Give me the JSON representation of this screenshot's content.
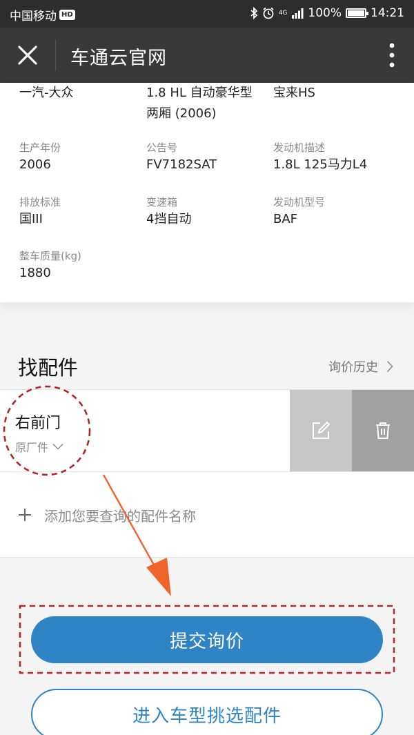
{
  "status_bar": {
    "carrier": "中国移动",
    "hd": "HD",
    "network": "4G",
    "battery": "100%",
    "battery_level": 1.0,
    "time": "14:21"
  },
  "nav": {
    "title": "车通云官网",
    "icons": {
      "close": "close-icon",
      "more": "more-icon"
    }
  },
  "vehicle": {
    "brand": "一汽-大众",
    "model_line1": "1.8 HL 自动豪华型",
    "model_line2": "两厢 (2006)",
    "series": "宝来HS",
    "fields": [
      {
        "label": "生产年份",
        "value": "2006"
      },
      {
        "label": "公告号",
        "value": "FV7182SAT"
      },
      {
        "label": "发动机描述",
        "value": "1.8L 125马力L4"
      },
      {
        "label": "排放标准",
        "value": "国III"
      },
      {
        "label": "变速箱",
        "value": "4挡自动"
      },
      {
        "label": "发动机型号",
        "value": "BAF"
      },
      {
        "label": "整车质量(kg)",
        "value": "1880"
      }
    ]
  },
  "parts": {
    "title": "找配件",
    "history_link": "询价历史",
    "items": [
      {
        "name": "右前门",
        "type": "原厂件"
      }
    ],
    "add_placeholder": "添加您要查询的配件名称"
  },
  "buttons": {
    "submit": "提交询价",
    "select_by_model": "进入车型挑选配件"
  },
  "colors": {
    "primary": "#2f84c6",
    "nav_bg": "#393939",
    "status_bg": "#2d2d2d",
    "annotation_red": "#b3262c",
    "annotation_arrow": "#f0642a"
  }
}
